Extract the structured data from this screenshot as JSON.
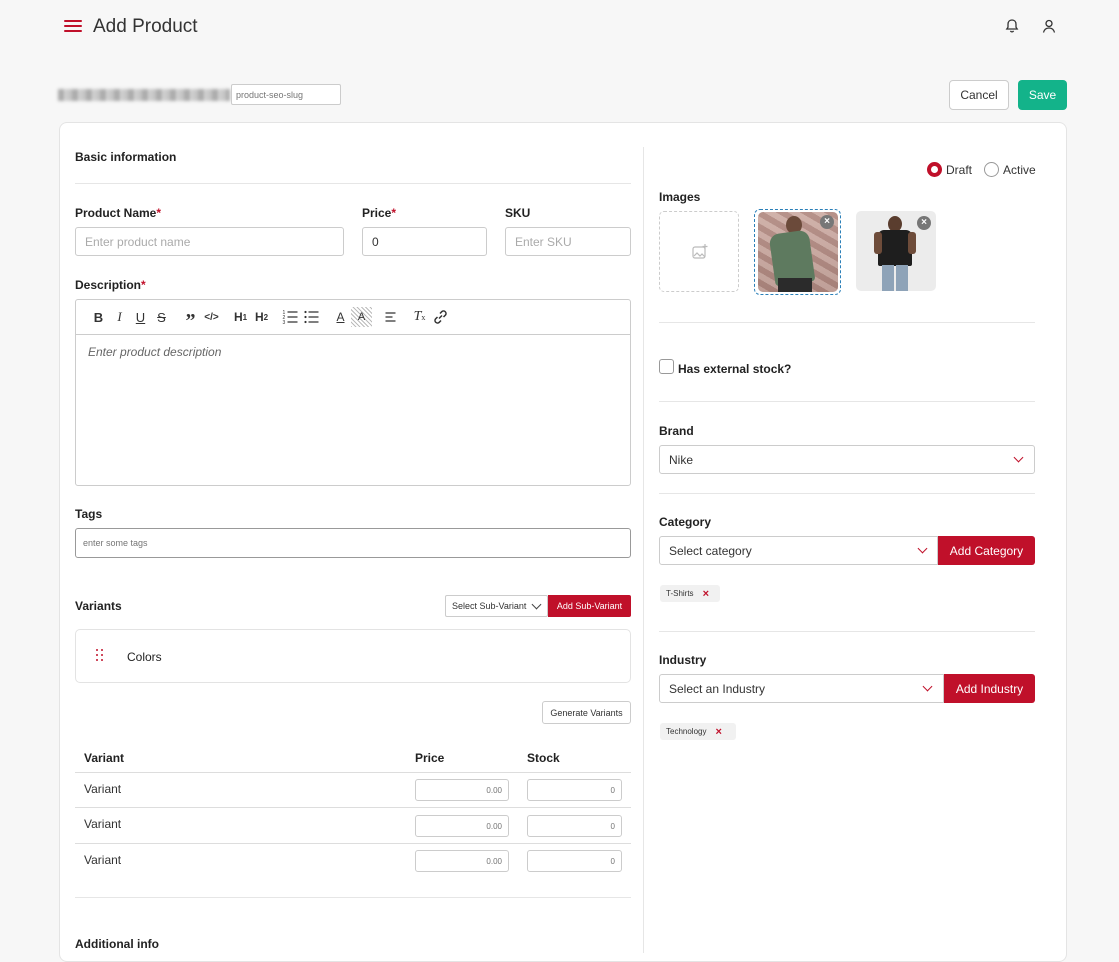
{
  "header": {
    "title": "Add Product"
  },
  "slug": {
    "placeholder": "product-seo-slug"
  },
  "actions": {
    "cancel": "Cancel",
    "save": "Save"
  },
  "basic": {
    "title": "Basic information",
    "product_name_label": "Product Name",
    "product_name_placeholder": "Enter product name",
    "price_label": "Price",
    "price_value": "0",
    "sku_label": "SKU",
    "sku_placeholder": "Enter SKU",
    "description_label": "Description",
    "description_placeholder": "Enter product description",
    "required_mark": "*"
  },
  "tags": {
    "label": "Tags",
    "placeholder": "enter some tags"
  },
  "variants": {
    "title": "Variants",
    "select_sub_variant": "Select Sub-Variant",
    "add_sub_variant": "Add Sub-Variant",
    "group_name": "Colors",
    "generate": "Generate Variants",
    "columns": [
      "Variant",
      "Price",
      "Stock"
    ],
    "rows": [
      {
        "name": "Variant",
        "price_placeholder": "0.00",
        "stock_placeholder": "0"
      },
      {
        "name": "Variant",
        "price_placeholder": "0.00",
        "stock_placeholder": "0"
      },
      {
        "name": "Variant",
        "price_placeholder": "0.00",
        "stock_placeholder": "0"
      }
    ]
  },
  "additional": {
    "title": "Additional info"
  },
  "status": {
    "draft": "Draft",
    "active": "Active",
    "selected": "Draft"
  },
  "images": {
    "label": "Images"
  },
  "external_stock": {
    "label": "Has external stock?",
    "checked": false
  },
  "brand": {
    "label": "Brand",
    "value": "Nike"
  },
  "category": {
    "label": "Category",
    "placeholder": "Select category",
    "add": "Add Category",
    "chips": [
      "T-Shirts"
    ]
  },
  "industry": {
    "label": "Industry",
    "placeholder": "Select an Industry",
    "add": "Add Industry",
    "chips": [
      "Technology"
    ]
  },
  "colors": {
    "accent": "#c0102a",
    "save": "#13b38a"
  },
  "icons": [
    "menu-icon",
    "bell-icon",
    "user-icon",
    "image-add-icon",
    "close-icon",
    "chevron-down-icon",
    "drag-handle-icon",
    "link-icon"
  ]
}
